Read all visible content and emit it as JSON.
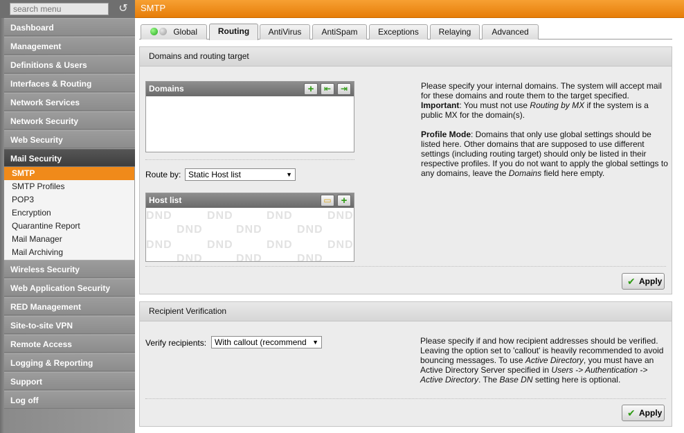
{
  "search": {
    "placeholder": "search menu",
    "reset_icon": "undo-icon"
  },
  "nav_top": [
    "Dashboard",
    "Management",
    "Definitions & Users",
    "Interfaces & Routing",
    "Network Services",
    "Network Security",
    "Web Security",
    "Mail Security"
  ],
  "nav_sub": [
    "SMTP",
    "SMTP Profiles",
    "POP3",
    "Encryption",
    "Quarantine Report",
    "Mail Manager",
    "Mail Archiving"
  ],
  "nav_bottom": [
    "Wireless Security",
    "Web Application Security",
    "RED Management",
    "Site-to-site VPN",
    "Remote Access",
    "Logging & Reporting",
    "Support",
    "Log off"
  ],
  "header": {
    "title": "SMTP"
  },
  "tabs": [
    "Global",
    "Routing",
    "AntiVirus",
    "AntiSpam",
    "Exceptions",
    "Relaying",
    "Advanced"
  ],
  "active_tab": "Routing",
  "colors": {
    "accent": "#f08a1a",
    "header": "#e67d08",
    "panel": "#ececec"
  },
  "routing": {
    "title": "Domains and routing target",
    "domains_title": "Domains",
    "route_by_label": "Route by:",
    "route_by_value": "Static Host list",
    "host_list_title": "Host list",
    "dnd": "DND",
    "apply": "Apply",
    "help1_a": "Please specify your internal domains. The system will accept mail for these domains and route them to the target specified.",
    "help1_b_bold": "Important",
    "help1_b_1": ": You must not use ",
    "help1_b_em": "Routing by MX",
    "help1_b_2": " if the system is a public MX for the domain(s).",
    "help2_bold": "Profile Mode",
    "help2_1": ": Domains that only use global settings should be listed here. Other domains that are supposed to use different settings (including routing target) should only be listed in their respective profiles. If you do not want to apply the global settings to any domains, leave the ",
    "help2_em": "Domains",
    "help2_2": " field here empty."
  },
  "recipient": {
    "title": "Recipient Verification",
    "verify_label": "Verify recipients:",
    "verify_value": "With callout (recommend",
    "apply": "Apply",
    "help_1": "Please specify if and how recipient addresses should be verified. Leaving the option set to 'callout' is heavily recommended to avoid bouncing messages. To use ",
    "help_em1": "Active Directory",
    "help_2": ", you must have an Active Directory Server specified in ",
    "help_em2": "Users -> Authentication -> Active Directory",
    "help_3": ". The ",
    "help_em3": "Base DN",
    "help_4": " setting here is optional."
  }
}
